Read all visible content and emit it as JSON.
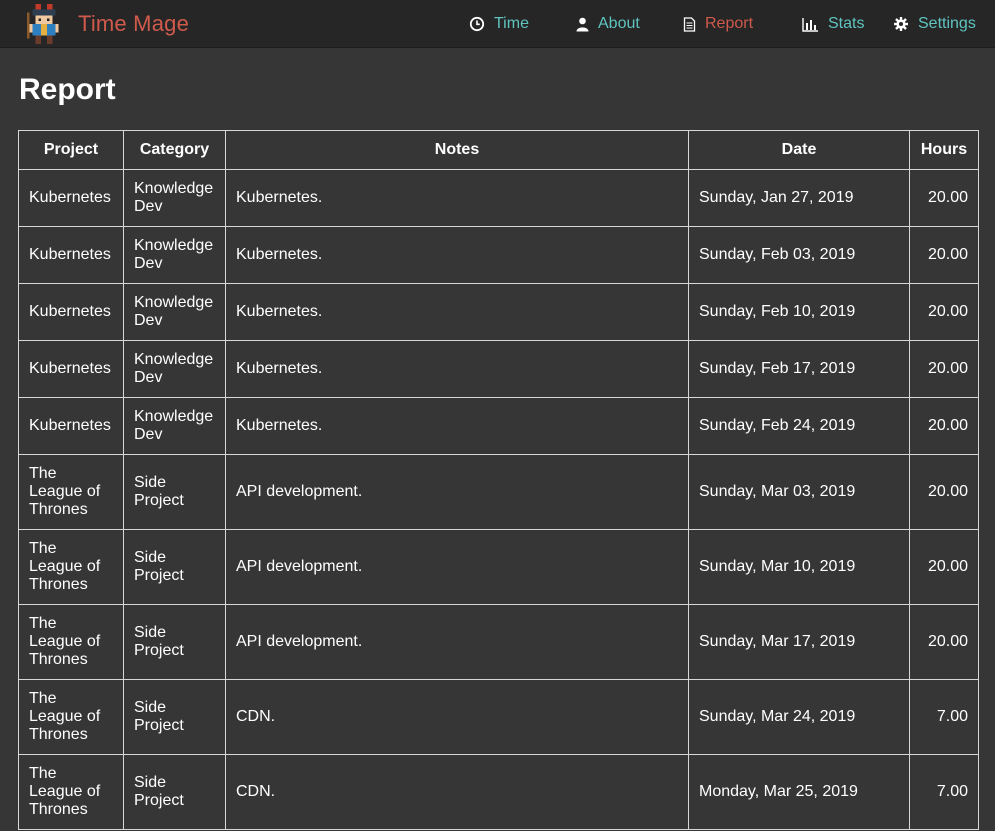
{
  "app": {
    "title": "Time Mage",
    "logo_icon": "pixel-mage-icon",
    "colors": {
      "brand": "#d05a4c",
      "nav": "#5fc4c0",
      "background": "#363636",
      "navbar": "#262626"
    }
  },
  "nav": {
    "time": "Time",
    "about": "About",
    "report": "Report",
    "stats": "Stats",
    "settings": "Settings",
    "active": "Report"
  },
  "page": {
    "title": "Report"
  },
  "table": {
    "headers": {
      "project": "Project",
      "category": "Category",
      "notes": "Notes",
      "date": "Date",
      "hours": "Hours"
    },
    "rows": [
      {
        "project": "Kubernetes",
        "category": "Knowledge Dev",
        "notes": "Kubernetes.",
        "date": "Sunday, Jan 27, 2019",
        "hours": "20.00"
      },
      {
        "project": "Kubernetes",
        "category": "Knowledge Dev",
        "notes": "Kubernetes.",
        "date": "Sunday, Feb 03, 2019",
        "hours": "20.00"
      },
      {
        "project": "Kubernetes",
        "category": "Knowledge Dev",
        "notes": "Kubernetes.",
        "date": "Sunday, Feb 10, 2019",
        "hours": "20.00"
      },
      {
        "project": "Kubernetes",
        "category": "Knowledge Dev",
        "notes": "Kubernetes.",
        "date": "Sunday, Feb 17, 2019",
        "hours": "20.00"
      },
      {
        "project": "Kubernetes",
        "category": "Knowledge Dev",
        "notes": "Kubernetes.",
        "date": "Sunday, Feb 24, 2019",
        "hours": "20.00"
      },
      {
        "project": "The League of Thrones",
        "category": "Side Project",
        "notes": "API development.",
        "date": "Sunday, Mar 03, 2019",
        "hours": "20.00"
      },
      {
        "project": "The League of Thrones",
        "category": "Side Project",
        "notes": "API development.",
        "date": "Sunday, Mar 10, 2019",
        "hours": "20.00"
      },
      {
        "project": "The League of Thrones",
        "category": "Side Project",
        "notes": "API development.",
        "date": "Sunday, Mar 17, 2019",
        "hours": "20.00"
      },
      {
        "project": "The League of Thrones",
        "category": "Side Project",
        "notes": "CDN.",
        "date": "Sunday, Mar 24, 2019",
        "hours": "7.00"
      },
      {
        "project": "The League of Thrones",
        "category": "Side Project",
        "notes": "CDN.",
        "date": "Monday, Mar 25, 2019",
        "hours": "7.00"
      }
    ]
  }
}
